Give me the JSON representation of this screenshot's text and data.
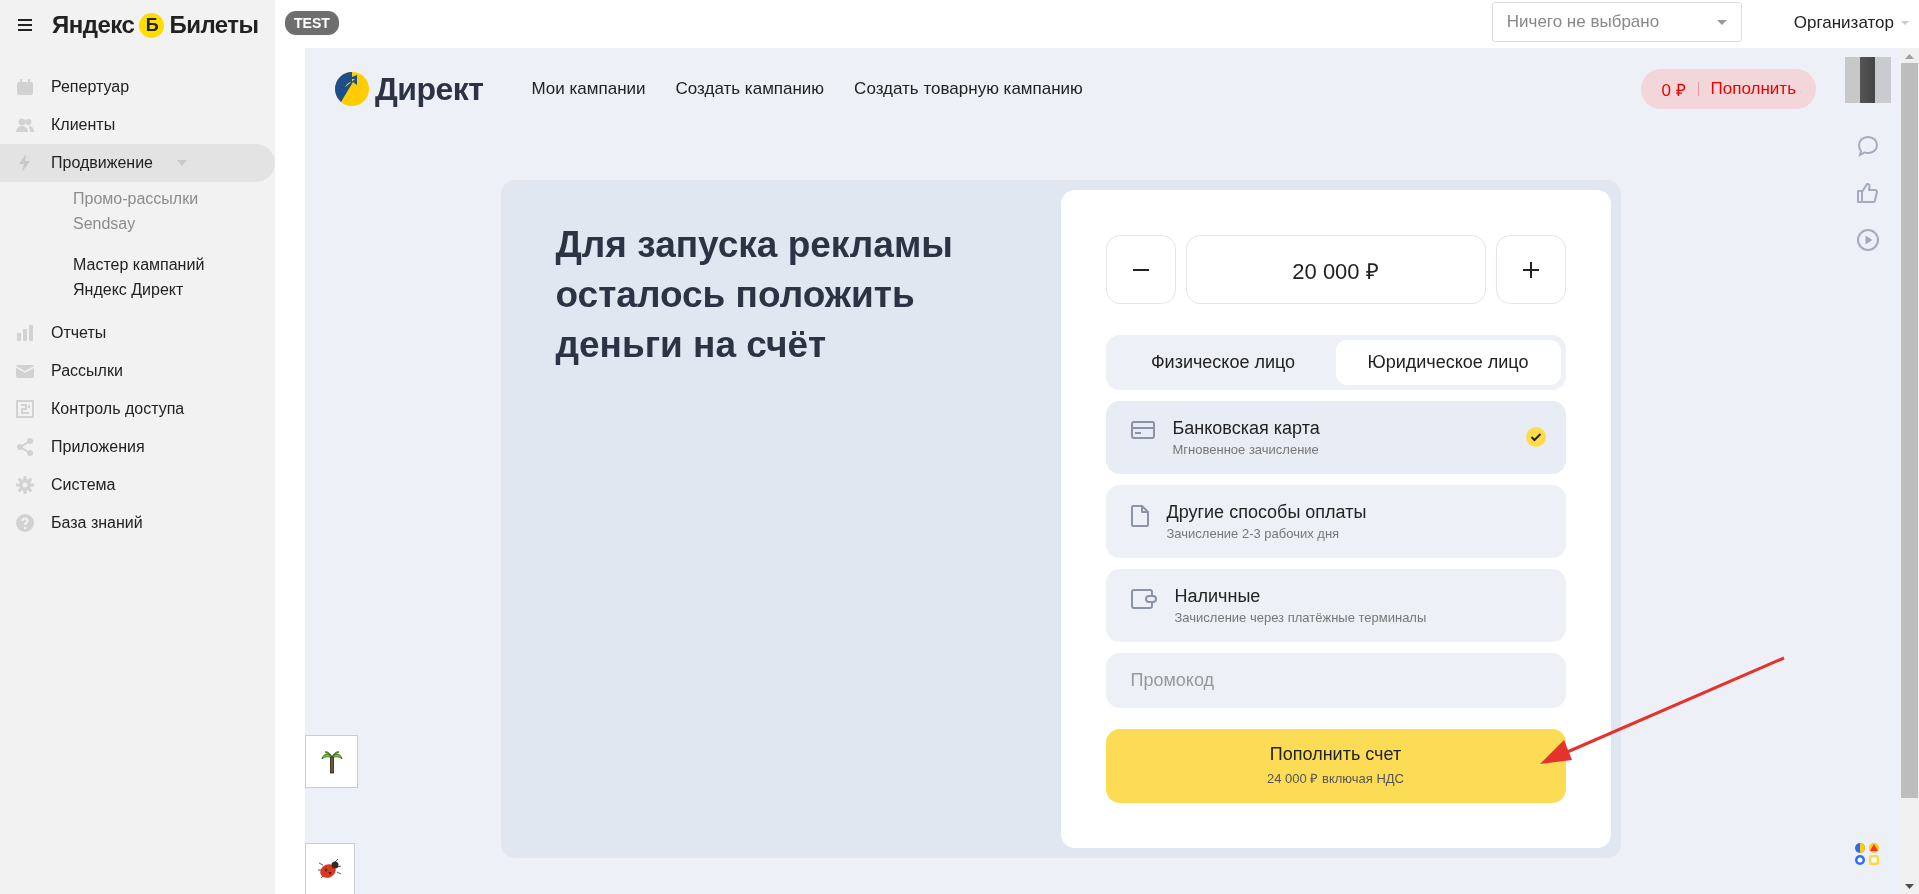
{
  "brand": {
    "left": "Яндекс",
    "badge": "Б",
    "right": "Билеты"
  },
  "env_badge": "TEST",
  "filter": {
    "placeholder": "Ничего не выбрано"
  },
  "role_menu": "Организатор",
  "sidebar": {
    "items": [
      {
        "label": "Репертуар",
        "kind": "calendar",
        "selected": false
      },
      {
        "label": "Клиенты",
        "kind": "people",
        "selected": false
      },
      {
        "label": "Продвижение",
        "kind": "bolt",
        "selected": true,
        "expanded": true,
        "children": [
          {
            "label": "Промо-рассылки Sendsay",
            "disabled": true
          },
          {
            "label": "Мастер кампаний Яндекс Директ",
            "disabled": false
          }
        ]
      },
      {
        "label": "Отчеты",
        "kind": "chart",
        "selected": false
      },
      {
        "label": "Рассылки",
        "kind": "mail",
        "selected": false
      },
      {
        "label": "Контроль доступа",
        "kind": "access",
        "selected": false
      },
      {
        "label": "Приложения",
        "kind": "share",
        "selected": false
      },
      {
        "label": "Система",
        "kind": "gear",
        "selected": false
      },
      {
        "label": "База знаний",
        "kind": "help",
        "selected": false
      }
    ]
  },
  "direct": {
    "logo": "Директ",
    "nav": [
      "Мои кампании",
      "Создать кампанию",
      "Создать товарную кампанию"
    ],
    "balance": {
      "amount": "0 ₽",
      "action": "Пополнить"
    }
  },
  "promo": {
    "heading": "Для запуска рекламы осталось положить деньги на счёт"
  },
  "payment": {
    "amount": "20 000 ₽",
    "tabs": [
      {
        "label": "Физическое лицо",
        "selected": false
      },
      {
        "label": "Юридическое лицо",
        "selected": true
      }
    ],
    "methods": [
      {
        "kind": "card",
        "title": "Банковская карта",
        "note": "Мгновенное зачисление",
        "selected": true
      },
      {
        "kind": "document",
        "title": "Другие способы оплаты",
        "note": "Зачисление 2-3 рабочих дня",
        "selected": false
      },
      {
        "kind": "wallet",
        "title": "Наличные",
        "note": "Зачисление через платёжные терминалы",
        "selected": false
      }
    ],
    "promo_code": {
      "placeholder": "Промокод"
    },
    "submit": {
      "label": "Пополнить счет",
      "note": "24 000 ₽ включая НДС"
    }
  }
}
